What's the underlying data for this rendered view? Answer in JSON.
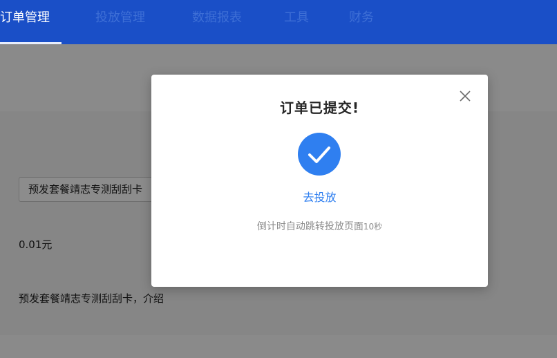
{
  "nav": {
    "tabs": [
      {
        "label": "订单管理",
        "active": true
      },
      {
        "label": "投放管理",
        "active": false
      },
      {
        "label": "数据报表",
        "active": false
      },
      {
        "label": "工具",
        "active": false
      },
      {
        "label": "财务",
        "active": false
      }
    ]
  },
  "form": {
    "package_value": "预发套餐靖志专测刮刮卡",
    "price": "0.01元",
    "description": "预发套餐靖志专测刮刮卡，介绍"
  },
  "modal": {
    "title": "订单已提交!",
    "icon": "check-circle-icon",
    "link_label": "去投放",
    "countdown_text": "倒计时自动跳转投放页面",
    "countdown_seconds": "10秒",
    "close_icon": "close-icon"
  },
  "colors": {
    "nav_bg": "#1a4fc7",
    "accent": "#2f7ff0"
  }
}
